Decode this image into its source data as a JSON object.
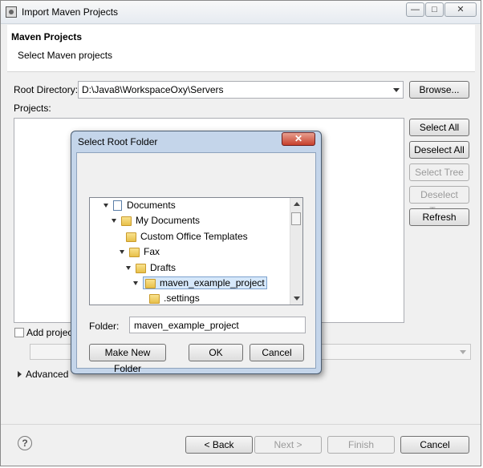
{
  "window": {
    "title": "Import Maven Projects",
    "controls": [
      "—",
      "□",
      "✕"
    ]
  },
  "header": {
    "title": "Maven Projects",
    "subtitle": "Select Maven projects"
  },
  "root_directory": {
    "label": "Root Directory:",
    "value": "D:\\Java8\\WorkspaceOxy\\Servers",
    "browse": "Browse..."
  },
  "projects": {
    "label": "Projects:"
  },
  "side_buttons": {
    "select_all": "Select All",
    "deselect_all": "Deselect All",
    "select_tree": "Select Tree",
    "deselect_tree": "Deselect Tree",
    "refresh": "Refresh"
  },
  "add_project_label": "Add project",
  "advanced_label": "Advanced",
  "footer": {
    "back": "< Back",
    "next": "Next >",
    "finish": "Finish",
    "cancel": "Cancel"
  },
  "dialog": {
    "title": "Select Root Folder",
    "close": "✕",
    "tree": [
      {
        "label": "Documents",
        "icon": "document-library-icon"
      },
      {
        "label": "My Documents",
        "icon": "folder-icon"
      },
      {
        "label": "Custom Office Templates",
        "icon": "folder-icon"
      },
      {
        "label": "Fax",
        "icon": "folder-icon"
      },
      {
        "label": "Drafts",
        "icon": "folder-icon"
      },
      {
        "label": "maven_example_project",
        "icon": "folder-icon",
        "selected": true
      },
      {
        "label": ".settings",
        "icon": "folder-icon"
      }
    ],
    "folder_label": "Folder:",
    "folder_value": "maven_example_project",
    "make_new_folder": "Make New Folder",
    "ok": "OK",
    "cancel": "Cancel"
  }
}
